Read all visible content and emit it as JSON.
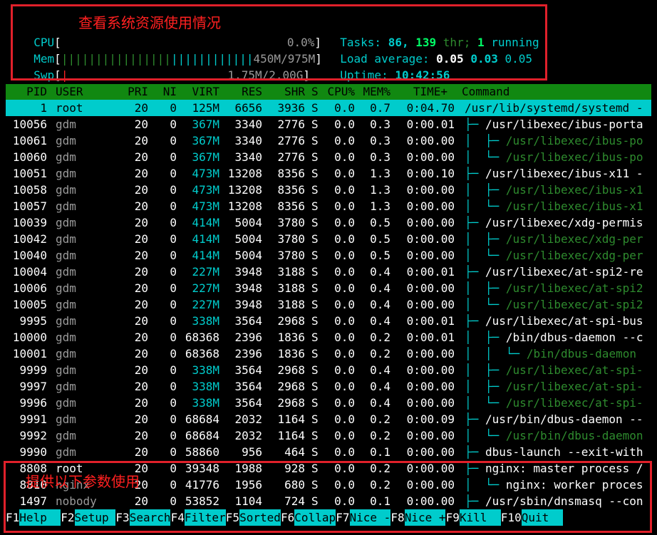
{
  "meters": {
    "cpu": {
      "label": "CPU",
      "value": "0.0%"
    },
    "mem": {
      "label": "Mem",
      "value": "450M/975M"
    },
    "swp": {
      "label": "Swp",
      "value": "1.75M/2.00G"
    }
  },
  "stats": {
    "tasks_label": "Tasks:",
    "tasks": "86,",
    "threads": "139",
    "thr_label": "thr;",
    "running": "1",
    "running_label": "running",
    "load_label": "Load average:",
    "load1": "0.05",
    "load5": "0.03",
    "load15": "0.05",
    "uptime_label": "Uptime:",
    "uptime": "10:42:56"
  },
  "annotations": {
    "top": "查看系统资源使用情况",
    "bottom": "提供以下参数使用"
  },
  "columns": [
    "PID",
    "USER",
    "PRI",
    "NI",
    "VIRT",
    "RES",
    "SHR",
    "S",
    "CPU%",
    "MEM%",
    "TIME+",
    "Command"
  ],
  "processes": [
    {
      "pid": "1",
      "user": "root",
      "pri": "20",
      "ni": "0",
      "virt": "125M",
      "res": "6656",
      "shr": "3936",
      "s": "S",
      "cpu": "0.0",
      "mem": "0.7",
      "time": "0:04.70",
      "tree": "",
      "cmd": "/usr/lib/systemd/systemd -",
      "selected": true,
      "thread": false
    },
    {
      "pid": "10056",
      "user": "gdm",
      "pri": "20",
      "ni": "0",
      "virt": "367M",
      "res": "3340",
      "shr": "2776",
      "s": "S",
      "cpu": "0.0",
      "mem": "0.3",
      "time": "0:00.01",
      "tree": "├─ ",
      "cmd": "/usr/libexec/ibus-porta",
      "thread": false
    },
    {
      "pid": "10061",
      "user": "gdm",
      "pri": "20",
      "ni": "0",
      "virt": "367M",
      "res": "3340",
      "shr": "2776",
      "s": "S",
      "cpu": "0.0",
      "mem": "0.3",
      "time": "0:00.00",
      "tree": "│  ├─ ",
      "cmd": "/usr/libexec/ibus-po",
      "thread": true
    },
    {
      "pid": "10060",
      "user": "gdm",
      "pri": "20",
      "ni": "0",
      "virt": "367M",
      "res": "3340",
      "shr": "2776",
      "s": "S",
      "cpu": "0.0",
      "mem": "0.3",
      "time": "0:00.00",
      "tree": "│  └─ ",
      "cmd": "/usr/libexec/ibus-po",
      "thread": true
    },
    {
      "pid": "10051",
      "user": "gdm",
      "pri": "20",
      "ni": "0",
      "virt": "473M",
      "res": "13208",
      "shr": "8356",
      "s": "S",
      "cpu": "0.0",
      "mem": "1.3",
      "time": "0:00.10",
      "tree": "├─ ",
      "cmd": "/usr/libexec/ibus-x11 -",
      "thread": false
    },
    {
      "pid": "10058",
      "user": "gdm",
      "pri": "20",
      "ni": "0",
      "virt": "473M",
      "res": "13208",
      "shr": "8356",
      "s": "S",
      "cpu": "0.0",
      "mem": "1.3",
      "time": "0:00.00",
      "tree": "│  ├─ ",
      "cmd": "/usr/libexec/ibus-x1",
      "thread": true
    },
    {
      "pid": "10057",
      "user": "gdm",
      "pri": "20",
      "ni": "0",
      "virt": "473M",
      "res": "13208",
      "shr": "8356",
      "s": "S",
      "cpu": "0.0",
      "mem": "1.3",
      "time": "0:00.00",
      "tree": "│  └─ ",
      "cmd": "/usr/libexec/ibus-x1",
      "thread": true
    },
    {
      "pid": "10039",
      "user": "gdm",
      "pri": "20",
      "ni": "0",
      "virt": "414M",
      "res": "5004",
      "shr": "3780",
      "s": "S",
      "cpu": "0.0",
      "mem": "0.5",
      "time": "0:00.00",
      "tree": "├─ ",
      "cmd": "/usr/libexec/xdg-permis",
      "thread": false
    },
    {
      "pid": "10042",
      "user": "gdm",
      "pri": "20",
      "ni": "0",
      "virt": "414M",
      "res": "5004",
      "shr": "3780",
      "s": "S",
      "cpu": "0.0",
      "mem": "0.5",
      "time": "0:00.00",
      "tree": "│  ├─ ",
      "cmd": "/usr/libexec/xdg-per",
      "thread": true
    },
    {
      "pid": "10040",
      "user": "gdm",
      "pri": "20",
      "ni": "0",
      "virt": "414M",
      "res": "5004",
      "shr": "3780",
      "s": "S",
      "cpu": "0.0",
      "mem": "0.5",
      "time": "0:00.00",
      "tree": "│  └─ ",
      "cmd": "/usr/libexec/xdg-per",
      "thread": true
    },
    {
      "pid": "10004",
      "user": "gdm",
      "pri": "20",
      "ni": "0",
      "virt": "227M",
      "res": "3948",
      "shr": "3188",
      "s": "S",
      "cpu": "0.0",
      "mem": "0.4",
      "time": "0:00.01",
      "tree": "├─ ",
      "cmd": "/usr/libexec/at-spi2-re",
      "thread": false
    },
    {
      "pid": "10006",
      "user": "gdm",
      "pri": "20",
      "ni": "0",
      "virt": "227M",
      "res": "3948",
      "shr": "3188",
      "s": "S",
      "cpu": "0.0",
      "mem": "0.4",
      "time": "0:00.00",
      "tree": "│  ├─ ",
      "cmd": "/usr/libexec/at-spi2",
      "thread": true
    },
    {
      "pid": "10005",
      "user": "gdm",
      "pri": "20",
      "ni": "0",
      "virt": "227M",
      "res": "3948",
      "shr": "3188",
      "s": "S",
      "cpu": "0.0",
      "mem": "0.4",
      "time": "0:00.00",
      "tree": "│  └─ ",
      "cmd": "/usr/libexec/at-spi2",
      "thread": true
    },
    {
      "pid": "9995",
      "user": "gdm",
      "pri": "20",
      "ni": "0",
      "virt": "338M",
      "res": "3564",
      "shr": "2968",
      "s": "S",
      "cpu": "0.0",
      "mem": "0.4",
      "time": "0:00.01",
      "tree": "├─ ",
      "cmd": "/usr/libexec/at-spi-bus",
      "thread": false
    },
    {
      "pid": "10000",
      "user": "gdm",
      "pri": "20",
      "ni": "0",
      "virt": "68368",
      "res": "2396",
      "shr": "1836",
      "s": "S",
      "cpu": "0.0",
      "mem": "0.2",
      "time": "0:00.01",
      "tree": "│  ├─ ",
      "cmd": "/bin/dbus-daemon --c",
      "thread": false
    },
    {
      "pid": "10001",
      "user": "gdm",
      "pri": "20",
      "ni": "0",
      "virt": "68368",
      "res": "2396",
      "shr": "1836",
      "s": "S",
      "cpu": "0.0",
      "mem": "0.2",
      "time": "0:00.00",
      "tree": "│  │  └─ ",
      "cmd": "/bin/dbus-daemon",
      "thread": true
    },
    {
      "pid": "9999",
      "user": "gdm",
      "pri": "20",
      "ni": "0",
      "virt": "338M",
      "res": "3564",
      "shr": "2968",
      "s": "S",
      "cpu": "0.0",
      "mem": "0.4",
      "time": "0:00.00",
      "tree": "│  ├─ ",
      "cmd": "/usr/libexec/at-spi-",
      "thread": true
    },
    {
      "pid": "9997",
      "user": "gdm",
      "pri": "20",
      "ni": "0",
      "virt": "338M",
      "res": "3564",
      "shr": "2968",
      "s": "S",
      "cpu": "0.0",
      "mem": "0.4",
      "time": "0:00.00",
      "tree": "│  ├─ ",
      "cmd": "/usr/libexec/at-spi-",
      "thread": true
    },
    {
      "pid": "9996",
      "user": "gdm",
      "pri": "20",
      "ni": "0",
      "virt": "338M",
      "res": "3564",
      "shr": "2968",
      "s": "S",
      "cpu": "0.0",
      "mem": "0.4",
      "time": "0:00.00",
      "tree": "│  └─ ",
      "cmd": "/usr/libexec/at-spi-",
      "thread": true
    },
    {
      "pid": "9991",
      "user": "gdm",
      "pri": "20",
      "ni": "0",
      "virt": "68684",
      "res": "2032",
      "shr": "1164",
      "s": "S",
      "cpu": "0.0",
      "mem": "0.2",
      "time": "0:00.09",
      "tree": "├─ ",
      "cmd": "/usr/bin/dbus-daemon --",
      "thread": false
    },
    {
      "pid": "9992",
      "user": "gdm",
      "pri": "20",
      "ni": "0",
      "virt": "68684",
      "res": "2032",
      "shr": "1164",
      "s": "S",
      "cpu": "0.0",
      "mem": "0.2",
      "time": "0:00.00",
      "tree": "│  └─ ",
      "cmd": "/usr/bin/dbus-daemon",
      "thread": true
    },
    {
      "pid": "9990",
      "user": "gdm",
      "pri": "20",
      "ni": "0",
      "virt": "58860",
      "res": "956",
      "shr": "464",
      "s": "S",
      "cpu": "0.0",
      "mem": "0.1",
      "time": "0:00.00",
      "tree": "├─ ",
      "cmd": "dbus-launch --exit-with",
      "thread": false
    },
    {
      "pid": "8808",
      "user": "root",
      "pri": "20",
      "ni": "0",
      "virt": "39348",
      "res": "1988",
      "shr": "928",
      "s": "S",
      "cpu": "0.0",
      "mem": "0.2",
      "time": "0:00.00",
      "tree": "├─ ",
      "cmd": "nginx: master process /",
      "thread": false
    },
    {
      "pid": "8810",
      "user": "nginx",
      "pri": "20",
      "ni": "0",
      "virt": "41776",
      "res": "1956",
      "shr": "680",
      "s": "S",
      "cpu": "0.0",
      "mem": "0.2",
      "time": "0:00.00",
      "tree": "│  └─ ",
      "cmd": "nginx: worker proces",
      "thread": false
    },
    {
      "pid": "1497",
      "user": "nobody",
      "pri": "20",
      "ni": "0",
      "virt": "53852",
      "res": "1104",
      "shr": "724",
      "s": "S",
      "cpu": "0.0",
      "mem": "0.1",
      "time": "0:00.00",
      "tree": "├─ ",
      "cmd": "/usr/sbin/dnsmasq --con",
      "thread": false
    }
  ],
  "fkeys": [
    {
      "key": "F1",
      "label": "Help  "
    },
    {
      "key": "F2",
      "label": "Setup "
    },
    {
      "key": "F3",
      "label": "Search"
    },
    {
      "key": "F4",
      "label": "Filter"
    },
    {
      "key": "F5",
      "label": "Sorted"
    },
    {
      "key": "F6",
      "label": "Collap"
    },
    {
      "key": "F7",
      "label": "Nice -"
    },
    {
      "key": "F8",
      "label": "Nice +"
    },
    {
      "key": "F9",
      "label": "Kill  "
    },
    {
      "key": "F10",
      "label": "Quit  "
    }
  ]
}
